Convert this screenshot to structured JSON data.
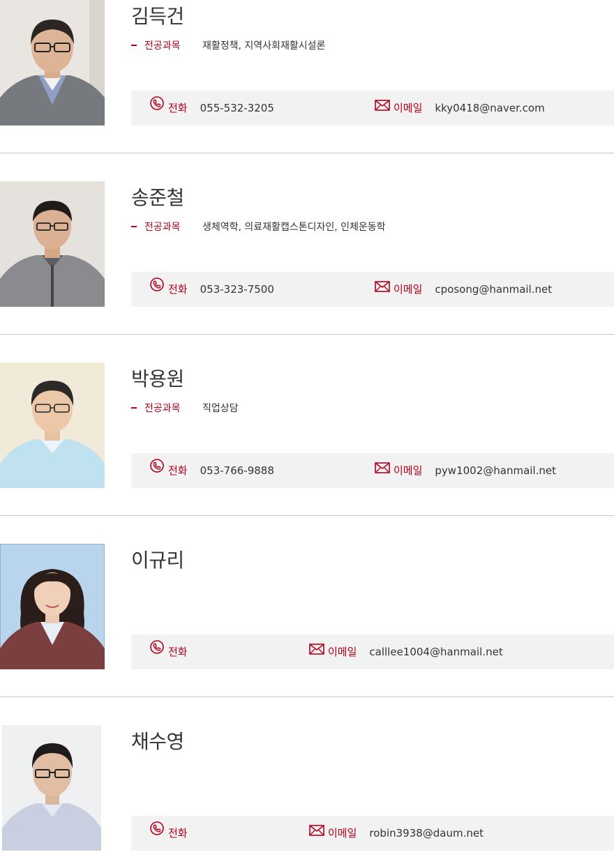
{
  "labels": {
    "major": "전공과목",
    "phone": "전화",
    "email": "이메일"
  },
  "colors": {
    "accent": "#b3001b",
    "contact_bg": "#f2f2f2",
    "divider": "#c8c8c8",
    "text": "#333333"
  },
  "icons": {
    "phone": "phone-icon",
    "email": "envelope-icon"
  },
  "faculty": [
    {
      "name": "김득건",
      "major": "재활정책, 지역사회재활시설론",
      "phone": "055-532-3205",
      "email": "kky0418@naver.com"
    },
    {
      "name": "송준철",
      "major": "생체역학, 의료재활캡스톤디자인, 인체운동학",
      "phone": "053-323-7500",
      "email": "cposong@hanmail.net"
    },
    {
      "name": "박용원",
      "major": "직업상담",
      "phone": "053-766-9888",
      "email": "pyw1002@hanmail.net"
    },
    {
      "name": "이규리",
      "major": "",
      "phone": "",
      "email": "calllee1004@hanmail.net"
    },
    {
      "name": "채수영",
      "major": "",
      "phone": "",
      "email": "robin3938@daum.net"
    }
  ]
}
